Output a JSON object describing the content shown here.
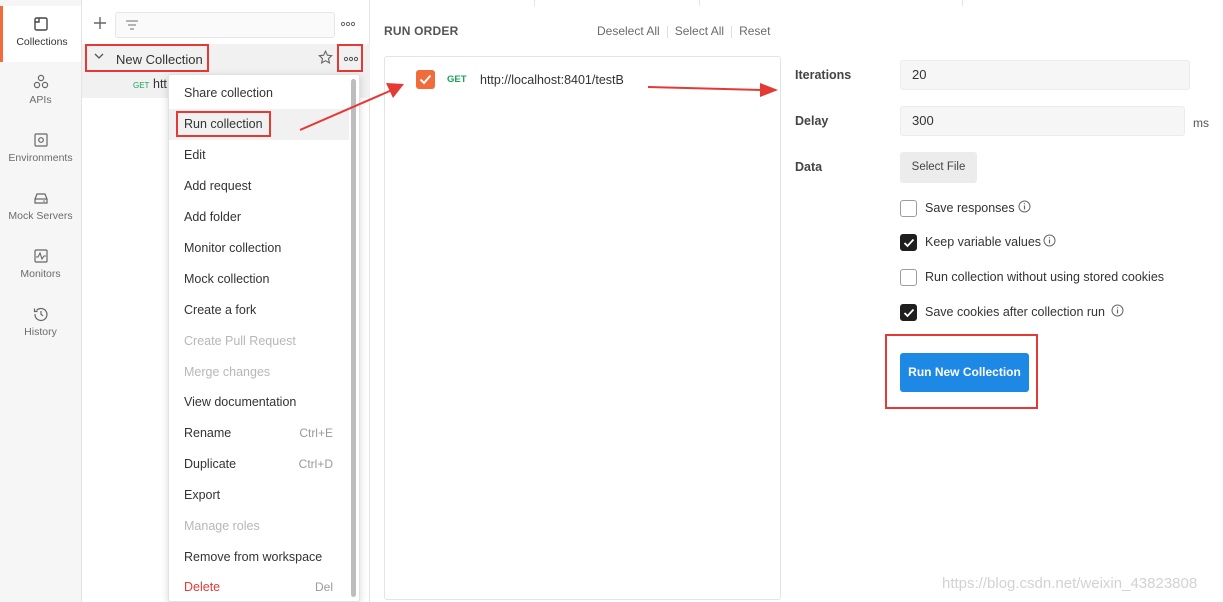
{
  "rail": {
    "items": [
      {
        "label": "Collections",
        "icon": "collections-icon",
        "active": true
      },
      {
        "label": "APIs",
        "icon": "apis-icon"
      },
      {
        "label": "Environments",
        "icon": "environments-icon"
      },
      {
        "label": "Mock Servers",
        "icon": "mock-servers-icon"
      },
      {
        "label": "Monitors",
        "icon": "monitors-icon"
      },
      {
        "label": "History",
        "icon": "history-icon"
      }
    ]
  },
  "sidebar": {
    "collection_name": "New Collection",
    "request_method": "GET",
    "request_name": "htt"
  },
  "menu": {
    "items": [
      {
        "label": "Share collection",
        "shortcut": "",
        "state": "normal"
      },
      {
        "label": "Run collection",
        "shortcut": "",
        "state": "highlighted"
      },
      {
        "label": "Edit",
        "shortcut": "",
        "state": "normal"
      },
      {
        "label": "Add request",
        "shortcut": "",
        "state": "normal"
      },
      {
        "label": "Add folder",
        "shortcut": "",
        "state": "normal"
      },
      {
        "label": "Monitor collection",
        "shortcut": "",
        "state": "normal"
      },
      {
        "label": "Mock collection",
        "shortcut": "",
        "state": "normal"
      },
      {
        "label": "Create a fork",
        "shortcut": "",
        "state": "normal"
      },
      {
        "label": "Create Pull Request",
        "shortcut": "",
        "state": "disabled"
      },
      {
        "label": "Merge changes",
        "shortcut": "",
        "state": "disabled"
      },
      {
        "label": "View documentation",
        "shortcut": "",
        "state": "normal"
      },
      {
        "label": "Rename",
        "shortcut": "Ctrl+E",
        "state": "normal"
      },
      {
        "label": "Duplicate",
        "shortcut": "Ctrl+D",
        "state": "normal"
      },
      {
        "label": "Export",
        "shortcut": "",
        "state": "normal"
      },
      {
        "label": "Manage roles",
        "shortcut": "",
        "state": "disabled"
      },
      {
        "label": "Remove from workspace",
        "shortcut": "",
        "state": "normal"
      },
      {
        "label": "Delete",
        "shortcut": "Del",
        "state": "danger"
      }
    ]
  },
  "run_order": {
    "title": "RUN ORDER",
    "deselect_all": "Deselect All",
    "select_all": "Select All",
    "reset": "Reset",
    "requests": [
      {
        "method": "GET",
        "url": "http://localhost:8401/testB",
        "checked": true
      }
    ]
  },
  "settings": {
    "iterations_label": "Iterations",
    "iterations_value": "20",
    "delay_label": "Delay",
    "delay_value": "300",
    "delay_unit": "ms",
    "data_label": "Data",
    "select_file": "Select File",
    "options": [
      {
        "label": "Save responses",
        "checked": false,
        "info": true
      },
      {
        "label": "Keep variable values",
        "checked": true,
        "info": true
      },
      {
        "label": "Run collection without using stored cookies",
        "checked": false,
        "info": false
      },
      {
        "label": "Save cookies after collection run",
        "checked": true,
        "info": true
      }
    ],
    "run_button": "Run New Collection"
  },
  "watermark": "https://blog.csdn.net/weixin_43823808",
  "colors": {
    "accent_orange": "#f26b3a",
    "primary_blue": "#1e88e5",
    "annotation_red": "#e53935",
    "get_green": "#1aa35a"
  }
}
